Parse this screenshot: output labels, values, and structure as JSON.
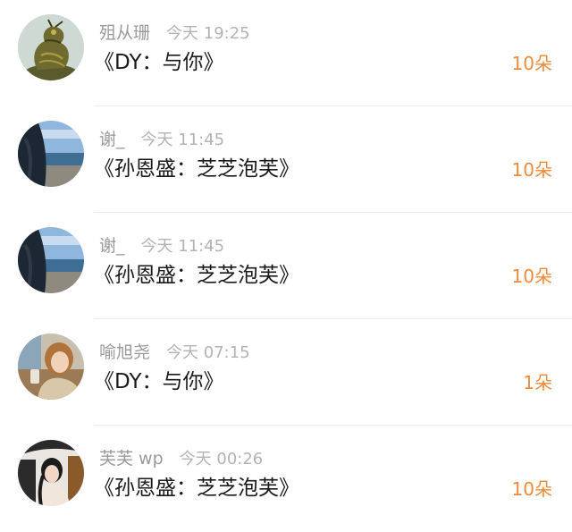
{
  "items": [
    {
      "name": "殂从珊",
      "time": "今天 19:25",
      "title": "《DY：与你》",
      "gift": "10朵",
      "avatar": "dragon-statue"
    },
    {
      "name": "谢_",
      "time": "今天 11:45",
      "title": "《孙恩盛：芝芝泡芙》",
      "gift": "10朵",
      "avatar": "beach-portrait"
    },
    {
      "name": "谢_",
      "time": "今天 11:45",
      "title": "《孙恩盛：芝芝泡芙》",
      "gift": "10朵",
      "avatar": "beach-portrait"
    },
    {
      "name": "喻旭尧",
      "time": "今天 07:15",
      "title": "《DY：与你》",
      "gift": "1朵",
      "avatar": "cafe-portrait"
    },
    {
      "name": "芙芙 wp",
      "time": "今天 00:26",
      "title": "《孙恩盛：芝芝泡芙》",
      "gift": "10朵",
      "avatar": "car-portrait"
    }
  ],
  "colors": {
    "gift_accent": "#f08a3a",
    "meta_text": "#9a9a9a",
    "title_text": "#1a1a1a"
  }
}
